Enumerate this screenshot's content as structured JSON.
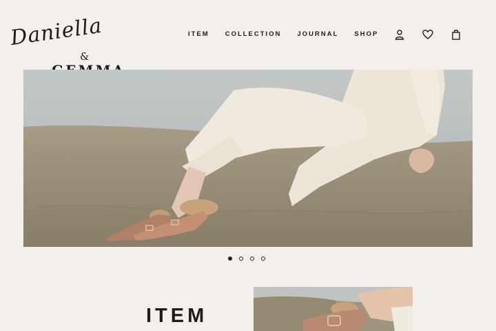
{
  "brand": {
    "script": "Daniella",
    "ampersand": "&",
    "word": "GEMMA"
  },
  "nav": {
    "items": [
      {
        "label": "ITEM"
      },
      {
        "label": "COLLECTION"
      },
      {
        "label": "JOURNAL"
      },
      {
        "label": "SHOP"
      }
    ]
  },
  "header_icons": [
    "user-icon",
    "heart-icon",
    "shopping-bag-icon"
  ],
  "hero": {
    "slide_count": 4,
    "active_slide": 1
  },
  "item_section": {
    "heading": "ITEM"
  },
  "colors": {
    "background": "#f3efea",
    "text": "#1e1c1a"
  }
}
